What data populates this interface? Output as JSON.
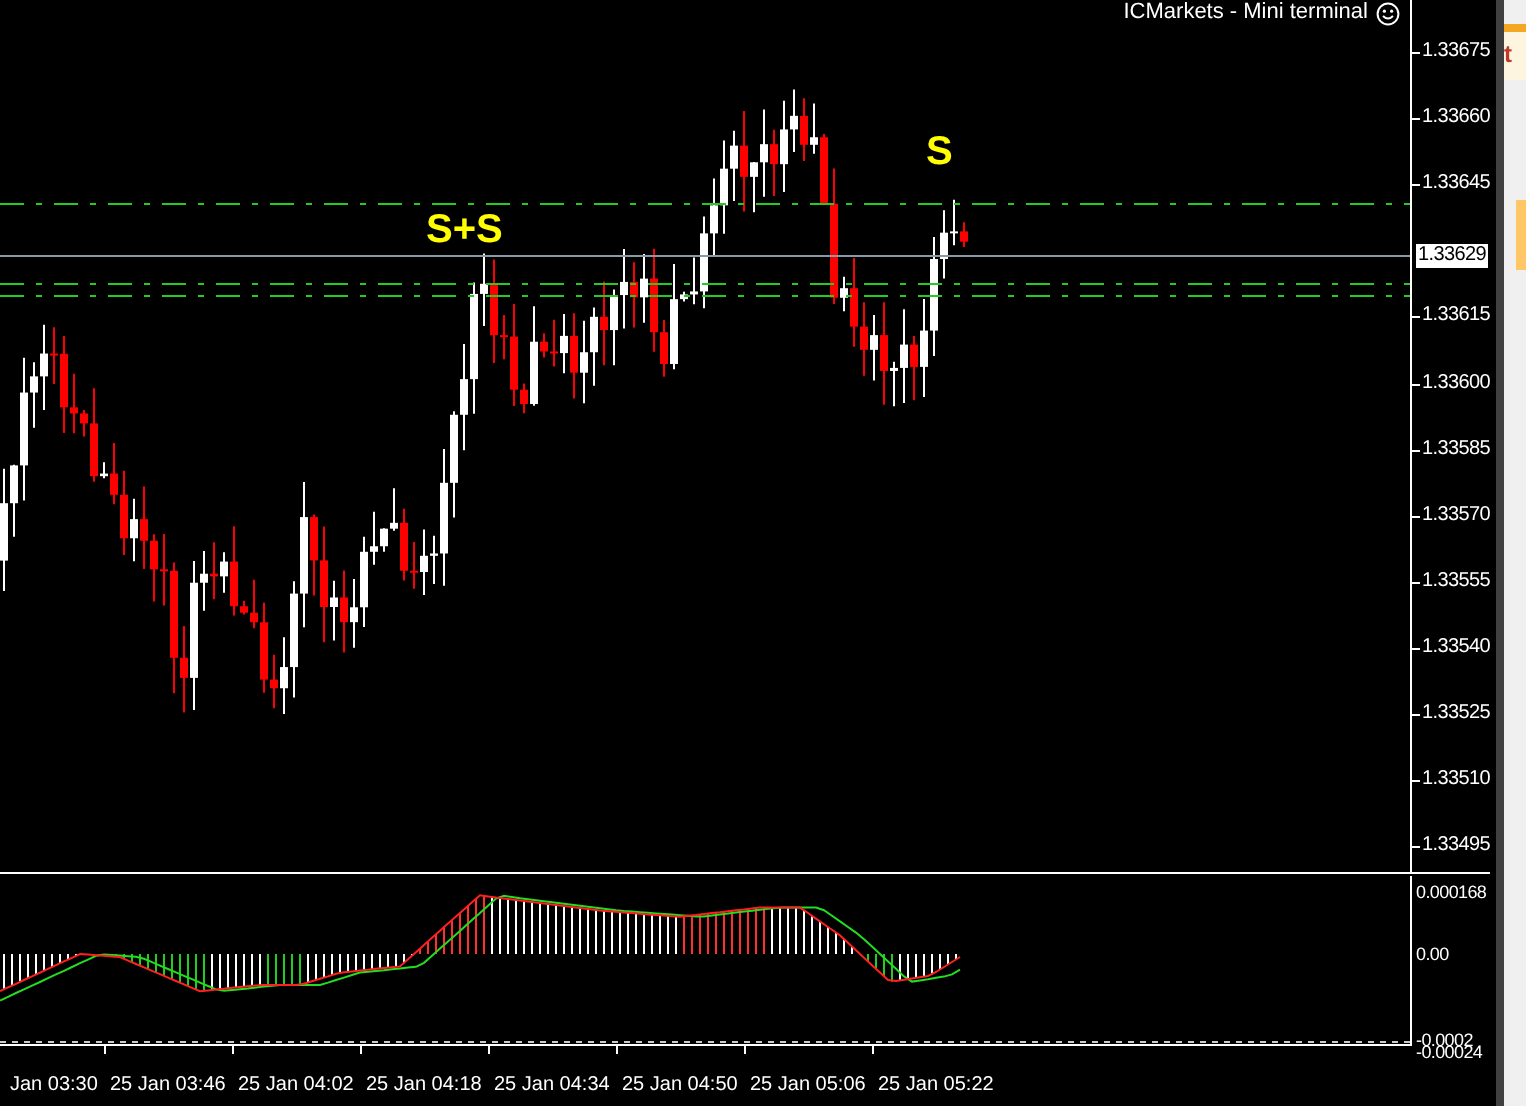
{
  "window": {
    "title": "ICMarkets - Mini terminal"
  },
  "price_axis": {
    "labels": [
      "1.33675",
      "1.33660",
      "1.33645",
      "1.33615",
      "1.33600",
      "1.33585",
      "1.33570",
      "1.33555",
      "1.33540",
      "1.33525",
      "1.33510",
      "1.33495"
    ],
    "current_price": "1.33629"
  },
  "signals": [
    {
      "label": "S+S"
    },
    {
      "label": "S"
    }
  ],
  "indicator": {
    "labels": [
      "0.000168",
      "0.00",
      "-0.0002",
      "-0.00024"
    ]
  },
  "time_axis": {
    "labels": [
      "Jan 03:30",
      "25 Jan 03:46",
      "25 Jan 04:02",
      "25 Jan 04:18",
      "25 Jan 04:34",
      "25 Jan 04:50",
      "25 Jan 05:06",
      "25 Jan 05:22"
    ]
  },
  "side_panel": {
    "text": "t"
  }
}
